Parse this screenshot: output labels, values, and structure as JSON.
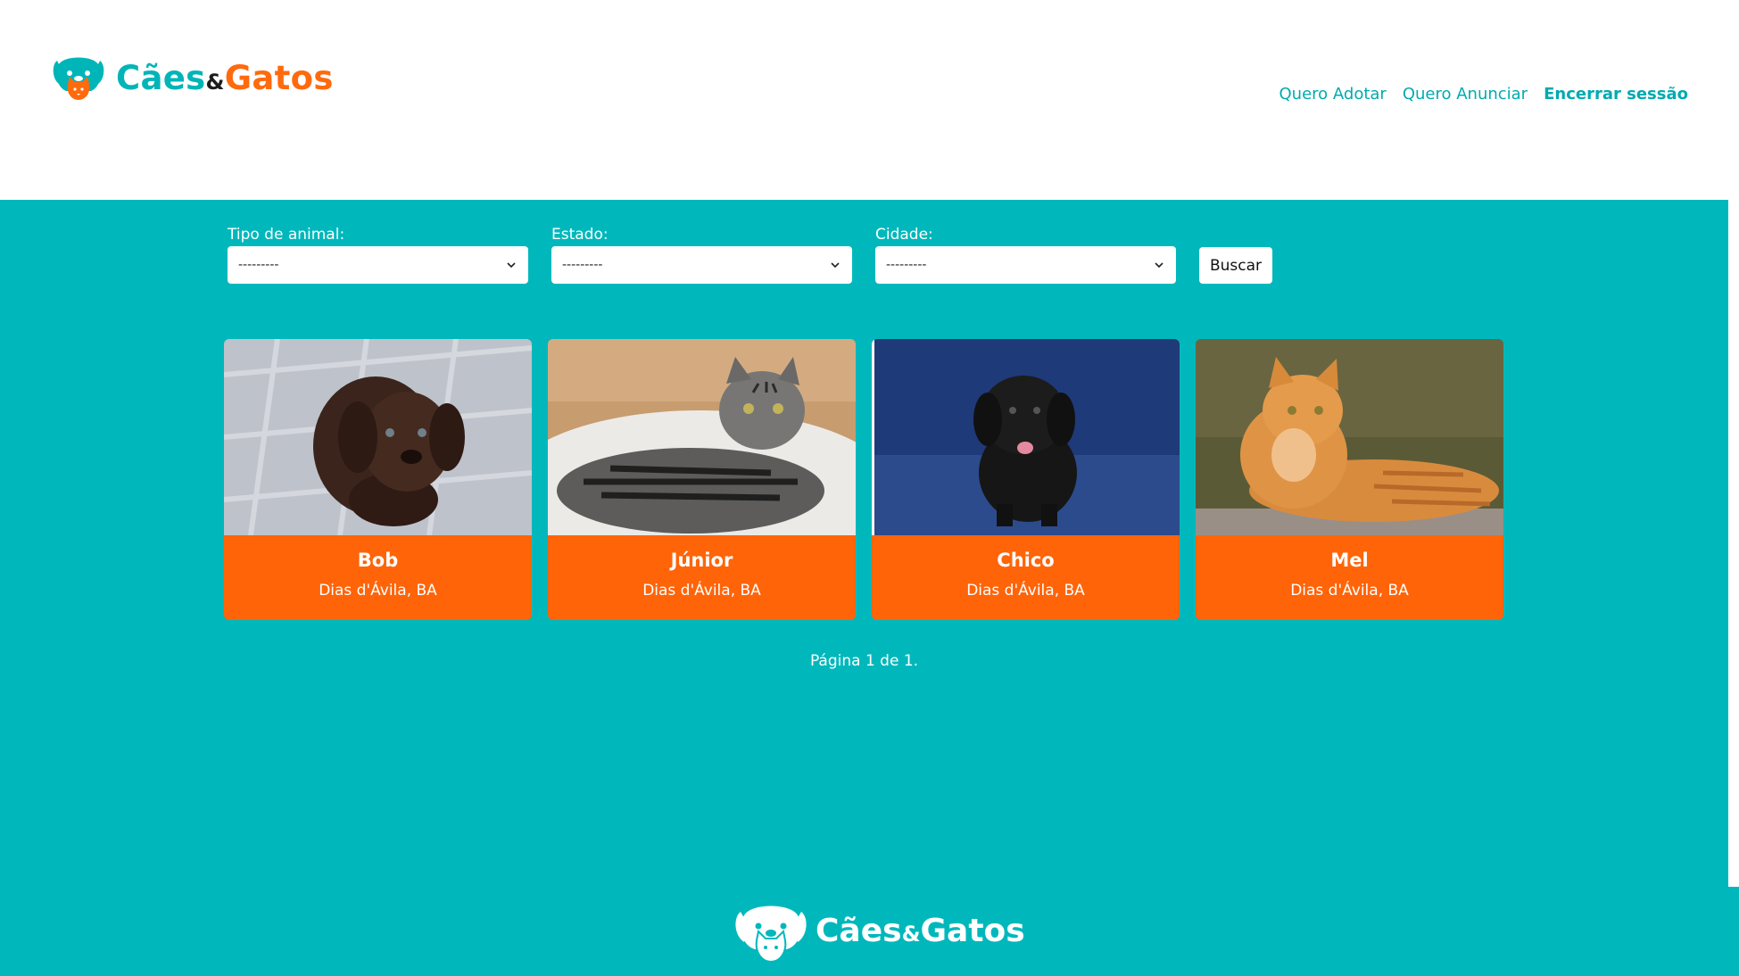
{
  "brand": {
    "name_part1": "Cães",
    "name_amp": "&",
    "name_part2": "Gatos"
  },
  "nav": {
    "adopt": "Quero Adotar",
    "advertise": "Quero Anunciar",
    "logout": "Encerrar sessão"
  },
  "filters": {
    "animal_type": {
      "label": "Tipo de animal:",
      "value": "---------"
    },
    "state": {
      "label": "Estado:",
      "value": "---------"
    },
    "city": {
      "label": "Cidade:",
      "value": "---------"
    },
    "search_label": "Buscar"
  },
  "pets": [
    {
      "name": "Bob",
      "location": "Dias d'Ávila, BA"
    },
    {
      "name": "Júnior",
      "location": "Dias d'Ávila, BA"
    },
    {
      "name": "Chico",
      "location": "Dias d'Ávila, BA"
    },
    {
      "name": "Mel",
      "location": "Dias d'Ávila, BA"
    }
  ],
  "pagination": {
    "text": "Página 1 de 1."
  },
  "colors": {
    "teal": "#00b8bc",
    "orange": "#ff6409",
    "white": "#ffffff"
  },
  "icons": [
    "pet-logo-icon",
    "chevron-down-icon"
  ]
}
